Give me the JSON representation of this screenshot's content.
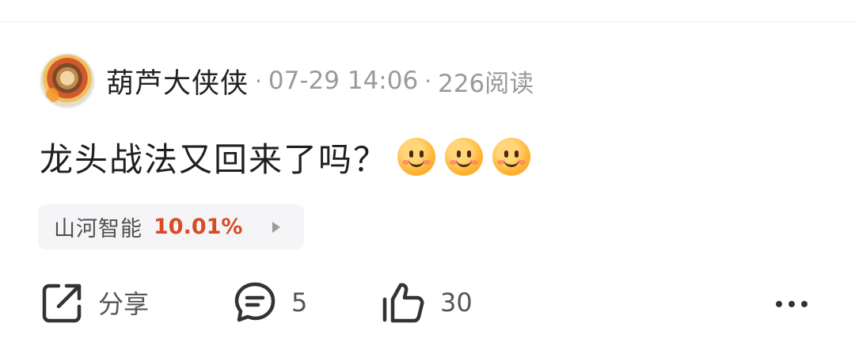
{
  "post": {
    "author": "葫芦大侠侠",
    "separator": "·",
    "date": "07-29 14:06",
    "reads": "226阅读",
    "text": "龙头战法又回来了吗？",
    "emojis": [
      "smile-emoji",
      "smile-emoji",
      "smile-emoji"
    ]
  },
  "stock_tag": {
    "name": "山河智能",
    "change": "10.01%",
    "change_color": "#d84b24"
  },
  "actions": {
    "share_label": "分享",
    "comment_count": "5",
    "like_count": "30"
  },
  "icons": {
    "share": "share-icon",
    "comment": "comment-icon",
    "like": "thumbs-up-icon",
    "more": "more-dots-icon"
  }
}
